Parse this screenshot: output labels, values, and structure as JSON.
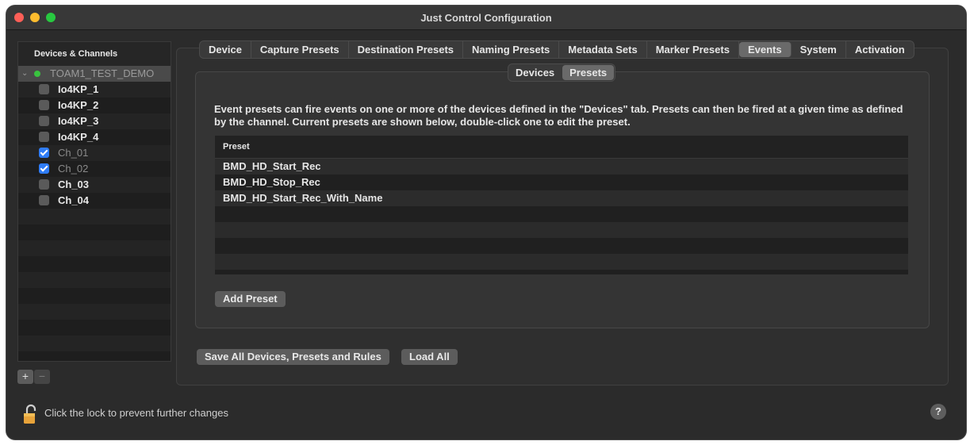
{
  "window": {
    "title": "Just Control Configuration"
  },
  "sidebar": {
    "header": "Devices & Channels",
    "root": {
      "label": "TOAM1_TEST_DEMO",
      "status_color": "#39c33f"
    },
    "items": [
      {
        "label": "Io4KP_1",
        "checked": false,
        "dim": false
      },
      {
        "label": "Io4KP_2",
        "checked": false,
        "dim": false
      },
      {
        "label": "Io4KP_3",
        "checked": false,
        "dim": false
      },
      {
        "label": "Io4KP_4",
        "checked": false,
        "dim": false
      },
      {
        "label": "Ch_01",
        "checked": true,
        "dim": true
      },
      {
        "label": "Ch_02",
        "checked": true,
        "dim": true
      },
      {
        "label": "Ch_03",
        "checked": false,
        "dim": false
      },
      {
        "label": "Ch_04",
        "checked": false,
        "dim": false
      }
    ],
    "add_label": "+",
    "remove_label": "−"
  },
  "tabs": {
    "items": [
      "Device",
      "Capture Presets",
      "Destination Presets",
      "Naming Presets",
      "Metadata Sets",
      "Marker Presets",
      "Events",
      "System",
      "Activation"
    ],
    "selected": "Events"
  },
  "subtabs": {
    "items": [
      "Devices",
      "Presets"
    ],
    "selected": "Presets"
  },
  "description": "Event presets can fire events on one or more of the devices defined in the \"Devices\" tab. Presets can then be fired at a given time as defined by the channel. Current presets are shown below, double-click one to edit the preset.",
  "table": {
    "column_header": "Preset",
    "rows": [
      "BMD_HD_Start_Rec",
      "BMD_HD_Stop_Rec",
      "BMD_HD_Start_Rec_With_Name"
    ]
  },
  "buttons": {
    "add_preset": "Add Preset",
    "save_all": "Save All Devices, Presets and Rules",
    "load_all": "Load All"
  },
  "footer": {
    "lock_text": "Click the lock to prevent further changes",
    "help_label": "?"
  },
  "colors": {
    "accent": "#2f7cf6",
    "status_online": "#39c33f",
    "window_bg": "#2b2b2b"
  }
}
